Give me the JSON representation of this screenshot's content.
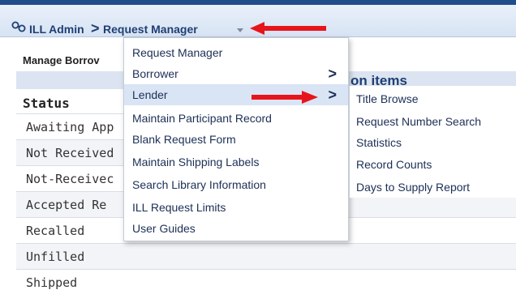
{
  "breadcrumb": {
    "root_label": "ILL Admin",
    "current_label": "Request Manager",
    "separator": ">"
  },
  "page": {
    "manage_title": "Manage Borrov",
    "section_heading": "on items",
    "status_heading": "Status"
  },
  "status_rows": [
    "Awaiting App",
    "Not Received",
    "Not-Receivec",
    "Accepted Re",
    "Recalled",
    "Unfilled",
    "Shipped"
  ],
  "menu": {
    "items": [
      {
        "label": "Request Manager",
        "submenu": false
      },
      {
        "label": "Borrower",
        "submenu": true
      },
      {
        "label": "Lender",
        "submenu": true,
        "highlighted": true
      },
      {
        "label": "Maintain Participant Record",
        "submenu": false
      },
      {
        "label": "Blank Request Form",
        "submenu": false
      },
      {
        "label": "Maintain Shipping Labels",
        "submenu": false
      },
      {
        "label": "Search Library Information",
        "submenu": false
      },
      {
        "label": "ILL Request Limits",
        "submenu": false
      },
      {
        "label": "User Guides",
        "submenu": false
      }
    ],
    "chevron": ">"
  },
  "lender_submenu": {
    "items": [
      "Title Browse",
      "Request Number Search",
      "Statistics",
      "Record Counts",
      "Days to Supply Report"
    ]
  },
  "colors": {
    "annotation_arrow": "#e8141c",
    "menu_highlight": "#d9e5f5",
    "link_text": "#1c2f56"
  },
  "icons": {
    "breadcrumb": "link-chain-icon",
    "dropdown": "caret-down-icon",
    "submenu": "chevron-right-icon"
  }
}
